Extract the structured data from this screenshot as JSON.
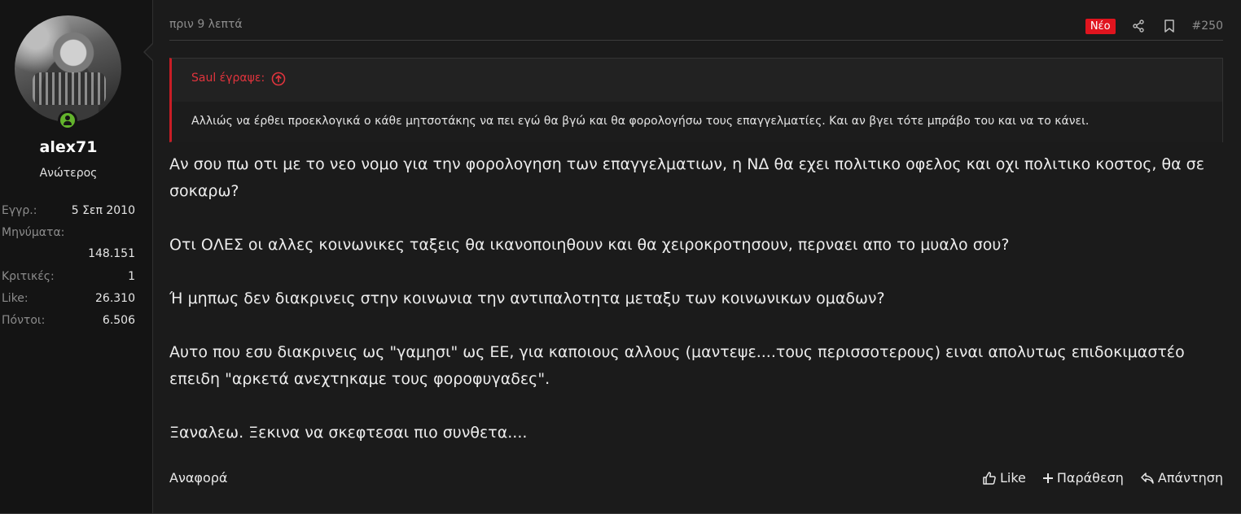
{
  "user": {
    "name": "alex71",
    "title": "Ανώτερος",
    "stats": [
      {
        "label": "Εγγρ.:",
        "value": "5 Σεπ 2010"
      },
      {
        "label": "Μηνύματα:",
        "value": "148.151"
      },
      {
        "label": "Κριτικές:",
        "value": "1"
      },
      {
        "label": "Like:",
        "value": "26.310"
      },
      {
        "label": "Πόντοι:",
        "value": "6.506"
      }
    ]
  },
  "post": {
    "time": "πριν 9 λεπτά",
    "new_badge": "Νέο",
    "number": "#250",
    "quote": {
      "author": "Saul έγραψε:",
      "text": "Αλλιώς να έρθει προεκλογικά ο κάθε μητσοτάκης να πει εγώ θα βγώ και θα φορολογήσω τους επαγγελματίες. Και αν βγει τότε μπράβο του και να το κάνει."
    },
    "paragraphs": [
      "Αν σου πω οτι με το νεο νομο για την φορολογηση των επαγγελματιων, η ΝΔ θα εχει πολιτικο οφελος και οχι πολιτικο κοστος, θα σε σοκαρω?",
      "Οτι ΟΛΕΣ οι αλλες κοινωνικες ταξεις θα ικανοποιηθουν και θα χειροκροτησουν, περναει απο το μυαλο σου?",
      "Ή μηπως δεν διακρινεις στην κοινωνια την αντιπαλοτητα μεταξυ των κοινωνικων ομαδων?",
      "Αυτο που εσυ διακρινεις ως \"γαμησι\" ως ΕΕ, για καποιους αλλους (μαντεψε....τους περισσοτερους) ειναι απολυτως επιδοκιμαστέο επειδη \"αρκετά ανεχτηκαμε τους φοροφυγαδες\".",
      "Ξαναλεω. Ξεκινα να σκεφτεσαι πιο συνθετα...."
    ]
  },
  "footer": {
    "report": "Αναφορά",
    "like": "Like",
    "quote": "Παράθεση",
    "reply": "Απάντηση"
  },
  "colors": {
    "accent": "#e0141e",
    "quote_author": "#e0343d",
    "online": "#63b32c"
  }
}
